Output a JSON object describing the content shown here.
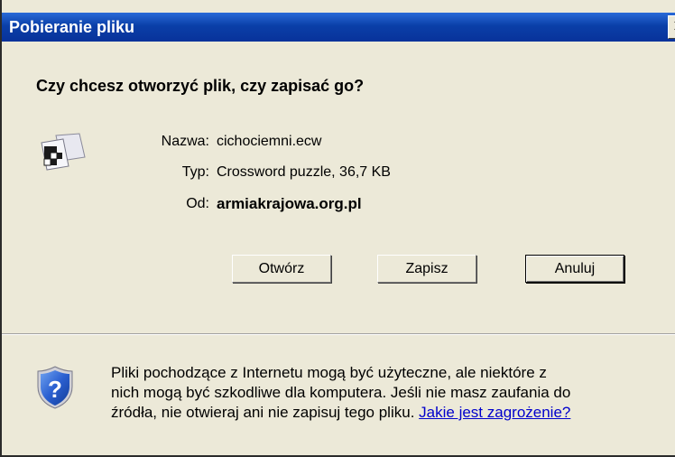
{
  "window": {
    "title": "Pobieranie pliku",
    "close_glyph": "✕"
  },
  "question": "Czy chcesz otworzyć plik, czy zapisać go?",
  "file": {
    "icon": "file-type-icon",
    "name_label": "Nazwa:",
    "name_value": "cichociemni.ecw",
    "type_label": "Typ:",
    "type_value": "Crossword puzzle, 36,7 KB",
    "from_label": "Od:",
    "from_value": "armiakrajowa.org.pl"
  },
  "buttons": {
    "open": "Otwórz",
    "save": "Zapisz",
    "cancel": "Anuluj"
  },
  "warning": {
    "icon": "shield-question-icon",
    "line1": "Pliki pochodzące z Internetu mogą być użyteczne, ale niektóre z",
    "line2": "nich mogą być szkodliwe dla komputera. Jeśli nie masz zaufania do",
    "line3": "źródła, nie otwieraj ani nie zapisuj tego pliku.",
    "link": "Jakie jest zagrożenie?"
  },
  "colors": {
    "titlebar": "#0a3fa8",
    "dialog_bg": "#ece9d8",
    "link": "#0000cc"
  }
}
